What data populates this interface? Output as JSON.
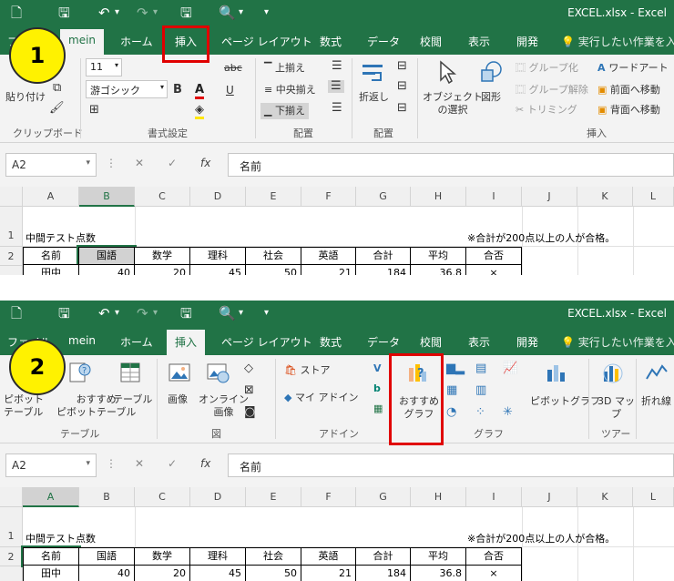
{
  "window_title": "EXCEL.xlsx  -  Excel",
  "tabs": [
    "ファイル",
    "mein",
    "ホーム",
    "挿入",
    "ページ レイアウト",
    "数式",
    "データ",
    "校閲",
    "表示",
    "開発"
  ],
  "tell_me": "実行したい作業を入力",
  "panel1": {
    "badge": "1",
    "clipboard": {
      "paste_label": "貼り付け",
      "group_label": "クリップボード"
    },
    "font": {
      "size": "11",
      "name": "游ゴシック",
      "bold": "B",
      "italic": "I",
      "underline": "U",
      "strike": "abc",
      "group_label": "書式設定"
    },
    "align": {
      "top": "上揃え",
      "middle": "中央揃え",
      "bottom": "下揃え",
      "wrap": "折返し",
      "group_label": "配置"
    },
    "arrange": {
      "group_label": "配置"
    },
    "insert": {
      "object_select": "オブジェクト\nの選択",
      "shape": "図形",
      "group": "グループ化",
      "ungroup": "グループ解除",
      "trim": "トリミング",
      "wordart": "ワードアート",
      "bring_front": "前面へ移動",
      "send_back": "背面へ移動",
      "group_label": "挿入"
    }
  },
  "panel2": {
    "badge": "2",
    "table": {
      "pivot": "ピボット\nテーブル",
      "rec_pivot": "おすすめ\nピボットテーブル",
      "table": "テーブル",
      "group_label": "テーブル"
    },
    "illust": {
      "image": "画像",
      "online": "オンライン\n画像",
      "group_label": "図"
    },
    "addin": {
      "store": "ストア",
      "my_addin": "マイ アドイン",
      "group_label": "アドイン"
    },
    "charts": {
      "recommended": "おすすめ\nグラフ",
      "pivot_chart": "ピボットグラフ",
      "group_label": "グラフ"
    },
    "tours": {
      "map3d": "3D マッ\nプ",
      "group_label": "ツアー"
    },
    "spark": {
      "line": "折れ線"
    }
  },
  "formula_bar": {
    "name_box": "A2",
    "content": "名前",
    "fx": "fx"
  },
  "columns": [
    "A",
    "B",
    "C",
    "D",
    "E",
    "F",
    "G",
    "H",
    "I",
    "J",
    "K",
    "L"
  ],
  "rows": [
    "1",
    "2"
  ],
  "sheet": {
    "a1": "中間テスト点数",
    "i1": "※合計が200点以上の人が合格。",
    "headers": [
      "名前",
      "国語",
      "数学",
      "理科",
      "社会",
      "英語",
      "合計",
      "平均",
      "合否"
    ],
    "row3_partial": [
      "田中",
      "40",
      "20",
      "45",
      "50",
      "21",
      "184",
      "36.8",
      "×"
    ]
  },
  "colors": {
    "accent": "#217346",
    "highlight": "#e00000",
    "badge": "#fff200"
  }
}
